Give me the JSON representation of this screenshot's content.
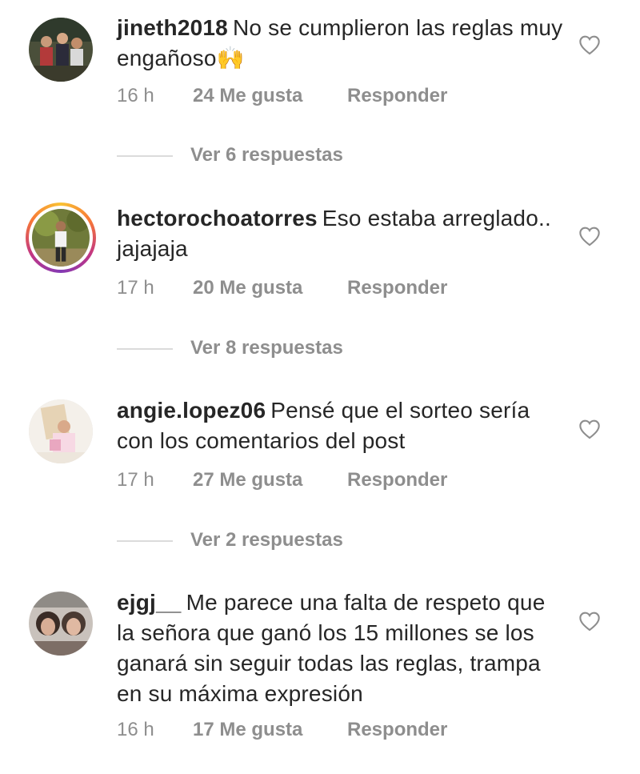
{
  "colors": {
    "text": "#262626",
    "muted": "#8e8e8e",
    "divider": "#dbdbdb"
  },
  "comments": [
    {
      "username": "jineth2018",
      "text": "No se cumplieron las reglas muy engañoso🙌",
      "time": "16 h",
      "likes": "24 Me gusta",
      "reply": "Responder",
      "view_replies": "Ver 6 respuestas",
      "icon": "heart-outline-icon"
    },
    {
      "username": "hectorochoatorres",
      "text": "Eso estaba arreglado.. jajajaja",
      "time": "17 h",
      "likes": "20 Me gusta",
      "reply": "Responder",
      "view_replies": "Ver 8 respuestas",
      "icon": "heart-outline-icon"
    },
    {
      "username": "angie.lopez06",
      "text": "Pensé que el sorteo sería con los comentarios del post",
      "time": "17 h",
      "likes": "27 Me gusta",
      "reply": "Responder",
      "view_replies": "Ver 2 respuestas",
      "icon": "heart-outline-icon"
    },
    {
      "username": "ejgj__",
      "text": "Me parece una falta de respeto que la señora que ganó los 15 millones se los ganará sin seguir todas las reglas, trampa en su máxima expresión",
      "time": "16 h",
      "likes": "17 Me gusta",
      "reply": "Responder",
      "icon": "heart-outline-icon"
    }
  ]
}
